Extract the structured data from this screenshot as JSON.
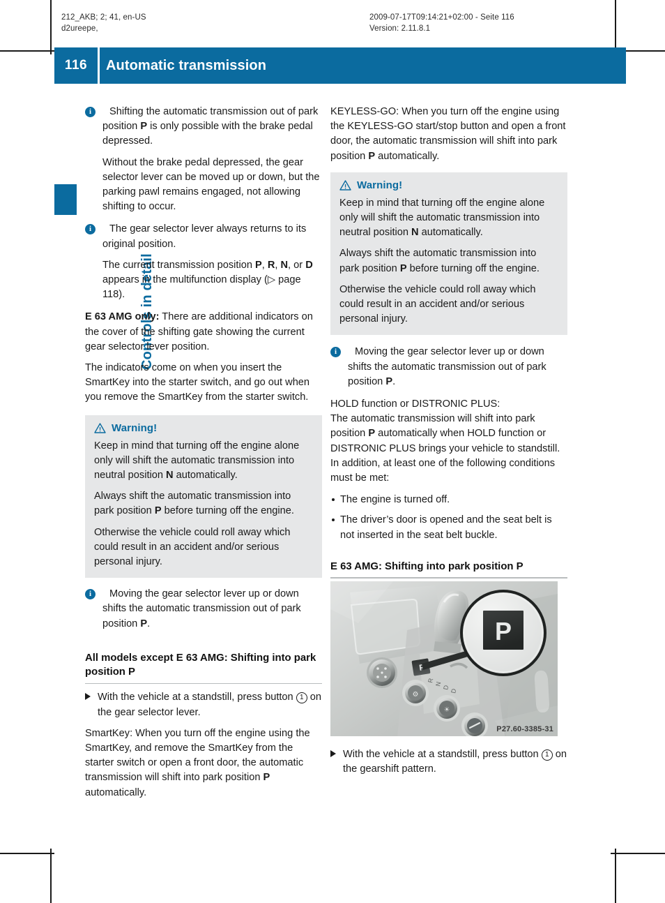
{
  "print_slug": {
    "left": "212_AKB; 2; 41, en-US\nd2ureepe,",
    "right": "2009-07-17T09:14:21+02:00 - Seite 116\nVersion: 2.11.8.1"
  },
  "header": {
    "page_number": "116",
    "title": "Automatic transmission"
  },
  "chapter_tab": {
    "label": "Controls in detail"
  },
  "left_column": {
    "note1": {
      "icon": "info-icon",
      "paragraphs": [
        "Shifting the automatic transmission out of park position P is only possible with the brake pedal depressed.",
        "Without the brake pedal depressed, the gear selector lever can be moved up or down, but the parking pawl remains engaged, not allowing shifting to occur."
      ]
    },
    "note2": {
      "icon": "info-icon",
      "paragraphs": [
        "The gear selector lever always returns to its original position.",
        "The current transmission position P, R, N, or D appears in the multifunction display (▷ page 118)."
      ]
    },
    "para_amg_lead": "E 63 AMG only:",
    "para_amg_rest": " There are additional indicators on the cover of the shifting gate showing the current gear selector lever position.",
    "para_indicators": "The indicators come on when you insert the SmartKey into the starter switch, and go out when you remove the SmartKey from the starter switch.",
    "warning": {
      "icon": "warning-triangle-icon",
      "title": "Warning!",
      "paragraphs": [
        "Keep in mind that turning off the engine alone only will shift the automatic transmission into neutral position N automatically.",
        "Always shift the automatic transmission into park position P before turning off the engine.",
        "Otherwise the vehicle could roll away which could result in an accident and/or serious personal injury."
      ]
    },
    "note3": {
      "icon": "info-icon",
      "paragraphs": [
        "Moving the gear selector lever up or down shifts the automatic transmission out of park position P."
      ]
    },
    "subheading": "All models except E 63 AMG: Shifting into park position P",
    "step": {
      "marker": "arrow-bullet-icon",
      "text_before": "With the vehicle at a standstill, press button ",
      "circled_number": "1",
      "text_after": " on the gear selector lever."
    },
    "para_smartkey": "SmartKey: When you turn off the engine using the SmartKey, and remove the SmartKey from the starter switch or open a front door, the automatic transmission will shift into park position P automatically."
  },
  "right_column": {
    "para_keyless": "KEYLESS-GO: When you turn off the engine using the KEYLESS-GO start/stop button and open a front door, the automatic transmission will shift into park position P automatically.",
    "warning": {
      "icon": "warning-triangle-icon",
      "title": "Warning!",
      "paragraphs": [
        "Keep in mind that turning off the engine alone only will shift the automatic transmission into neutral position N automatically.",
        "Always shift the automatic transmission into park position P before turning off the engine.",
        "Otherwise the vehicle could roll away which could result in an accident and/or serious personal injury."
      ]
    },
    "note1": {
      "icon": "info-icon",
      "paragraphs": [
        "Moving the gear selector lever up or down shifts the automatic transmission out of park position P."
      ]
    },
    "para_hold": "HOLD function or DISTRONIC PLUS:\nThe automatic transmission will shift into park position P automatically when HOLD function or DISTRONIC PLUS brings your vehicle to standstill. In addition, at least one of the following conditions must be met:",
    "conditions": [
      "The engine is turned off.",
      "The driver’s door is opened and the seat belt is not inserted in the seat belt buckle."
    ],
    "subheading": "E 63 AMG: Shifting into park position P",
    "figure": {
      "name": "gear-selector-console-photo",
      "magnifier_label": "P",
      "image_code": "P27.60-3385-31"
    },
    "step": {
      "marker": "arrow-bullet-icon",
      "text_before": "With the vehicle at a standstill, press button ",
      "circled_number": "1",
      "text_after": " on the gearshift pattern."
    }
  },
  "colors": {
    "brand_blue": "#0b6b9f",
    "warning_bg": "#e6e7e8",
    "rule_gray": "#b9bcbe",
    "body_text": "#1a1a1a"
  }
}
